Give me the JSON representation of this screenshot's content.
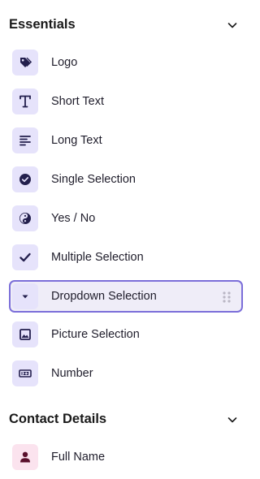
{
  "sections": [
    {
      "title": "Essentials",
      "toggle_icon": "chevron-down-icon",
      "items": [
        {
          "label": "Logo",
          "icon": "tag-icon"
        },
        {
          "label": "Short Text",
          "icon": "text-t-icon"
        },
        {
          "label": "Long Text",
          "icon": "paragraph-lines-icon"
        },
        {
          "label": "Single Selection",
          "icon": "check-circle-icon"
        },
        {
          "label": "Yes / No",
          "icon": "yin-yang-icon"
        },
        {
          "label": "Multiple Selection",
          "icon": "checkmark-icon"
        },
        {
          "label": "Dropdown Selection",
          "icon": "caret-down-icon",
          "selected": true
        },
        {
          "label": "Picture Selection",
          "icon": "image-icon"
        },
        {
          "label": "Number",
          "icon": "number-box-icon"
        }
      ]
    },
    {
      "title": "Contact Details",
      "toggle_icon": "chevron-down-icon",
      "items": [
        {
          "label": "Full Name",
          "icon": "person-icon"
        }
      ]
    }
  ],
  "colors": {
    "icon_tile": "#e6e3fb",
    "icon_tile_contact": "#fbe3ee",
    "icon_fill": "#231f4d",
    "icon_fill_contact": "#5a0f2c",
    "selected_border": "#7b6ed9",
    "selected_bg": "#efedf8"
  }
}
